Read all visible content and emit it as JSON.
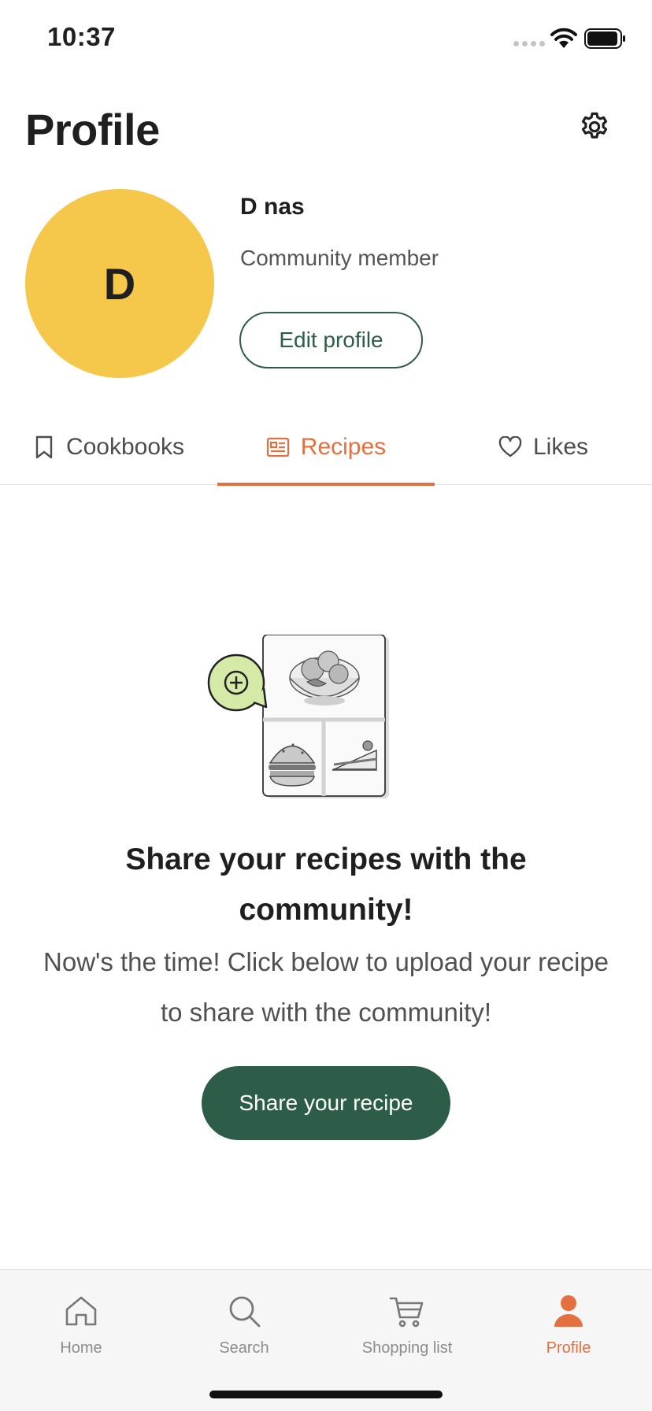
{
  "status_bar": {
    "time": "10:37"
  },
  "header": {
    "title": "Profile",
    "settings_icon": "gear-icon"
  },
  "profile": {
    "avatar_initial": "D",
    "avatar_color": "#f5c74b",
    "name": "D nas",
    "role": "Community member",
    "edit_label": "Edit profile"
  },
  "tabs": [
    {
      "label": "Cookbooks",
      "icon": "bookmark-icon",
      "active": false
    },
    {
      "label": "Recipes",
      "icon": "recipe-card-icon",
      "active": true
    },
    {
      "label": "Likes",
      "icon": "heart-icon",
      "active": false
    }
  ],
  "empty_state": {
    "title": "Share your recipes with the community!",
    "subtitle": "Now's the time! Click below to upload your recipe to share with the community!",
    "button_label": "Share your recipe"
  },
  "bottom_nav": [
    {
      "label": "Home",
      "icon": "home-icon",
      "active": false
    },
    {
      "label": "Search",
      "icon": "search-icon",
      "active": false
    },
    {
      "label": "Shopping list",
      "icon": "cart-icon",
      "active": false
    },
    {
      "label": "Profile",
      "icon": "person-icon",
      "active": true
    }
  ],
  "colors": {
    "accent": "#e4703f",
    "primary_green": "#2d5c48",
    "avatar_yellow": "#f5c74b",
    "illustration_green": "#d4eaa6"
  }
}
